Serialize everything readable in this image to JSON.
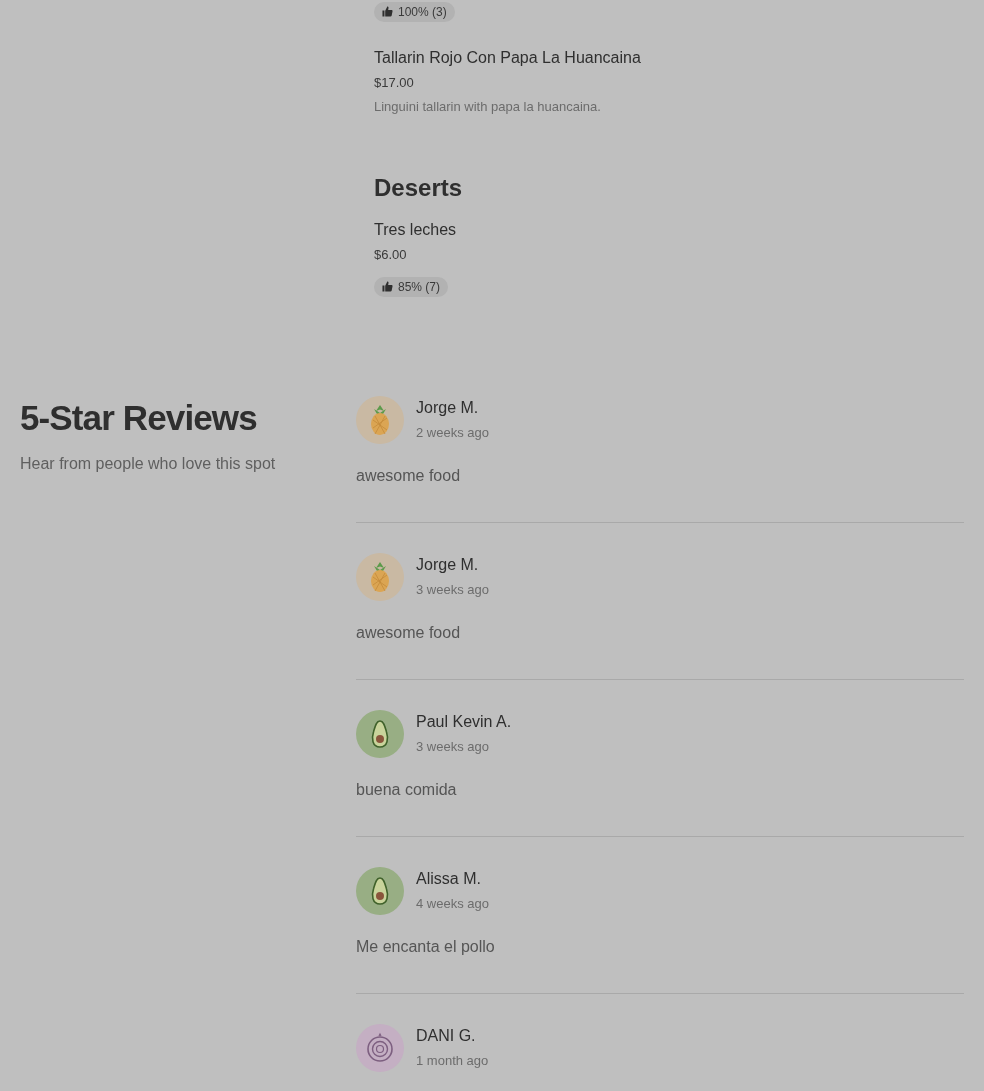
{
  "menu": [
    {
      "items": [
        {
          "rating": "100% (3)"
        },
        {
          "name": "Tallarin Rojo Con Papa La Huancaina",
          "price": "$17.00",
          "description": "Linguini tallarin with papa la huancaina."
        }
      ]
    },
    {
      "title": "Deserts",
      "items": [
        {
          "name": "Tres leches",
          "price": "$6.00",
          "rating": "85% (7)"
        }
      ]
    }
  ],
  "reviews": {
    "title": "5-Star Reviews",
    "subtitle": "Hear from people who love this spot",
    "items": [
      {
        "kind": "pineapple",
        "name": "Jorge M.",
        "time": "2 weeks ago",
        "text": "awesome food"
      },
      {
        "kind": "pineapple",
        "name": "Jorge M.",
        "time": "3 weeks ago",
        "text": "awesome food"
      },
      {
        "kind": "avocado",
        "name": "Paul Kevin A.",
        "time": "3 weeks ago",
        "text": "buena comida"
      },
      {
        "kind": "avocado",
        "name": "Alissa M.",
        "time": "4 weeks ago",
        "text": "Me encanta el pollo"
      },
      {
        "kind": "onion",
        "name": "DANI G.",
        "time": "1 month ago"
      }
    ]
  }
}
